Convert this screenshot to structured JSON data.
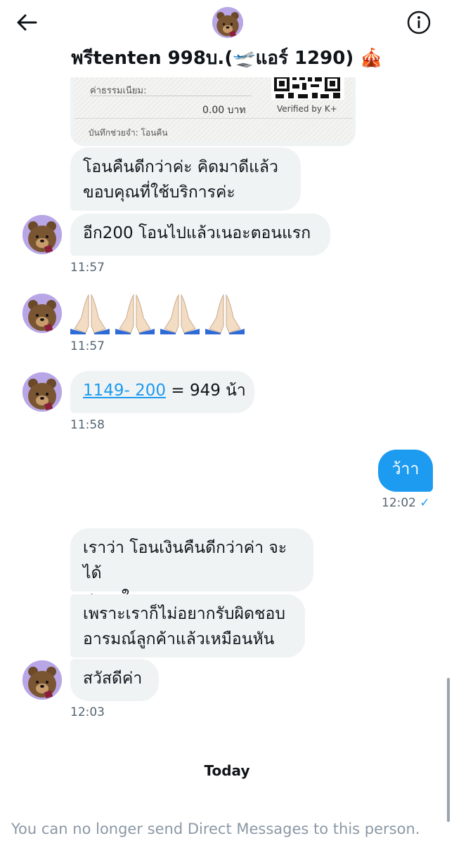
{
  "header": {
    "title": "พรีtenten 998บ.(🛫แอร์ 1290) 🎪",
    "back_icon": "back-arrow-icon",
    "info_icon": "info-icon"
  },
  "receipt": {
    "fee_label": "ค่าธรรมเนียม:",
    "fee_value": "0.00 บาท",
    "verified": "Verified by K+",
    "memo": "บันทึกช่วยจำ: โอนคืน"
  },
  "messages": [
    {
      "line1": "โอนคืนดีกว่าค่ะ คิดมาดีแล้ว",
      "line2": "ขอบคุณที่ใช้บริการค่ะ"
    },
    {
      "text": "อีก200 โอนไปแล้วเนอะตอนแรก",
      "time": "11:57"
    },
    {
      "emoji": "🙏🏻🙏🏻🙏🏻🙏🏻",
      "time": "11:57"
    },
    {
      "link": "1149- 200",
      "rest": " = 949 น้า",
      "time": "11:58"
    },
    {
      "text": "ว้าา",
      "time": "12:02",
      "status": "✓"
    },
    {
      "line1": "เราว่า โอนเงินคืนดีกว่าค่า จะได้",
      "line2": "สบายใจ"
    },
    {
      "line1": "เพราะเราก็ไม่อยากรับผิดชอบ",
      "line2": "อารมณ์ลูกค้าแล้วเหมือนหัน"
    },
    {
      "text": "สวัสดีค่า",
      "time": "12:03"
    }
  ],
  "divider": "Today",
  "notice": "You can no longer send Direct Messages to this person.",
  "colors": {
    "accent": "#1d9bf0",
    "bubble": "#eff3f4",
    "avatar_bg": "#b9a6e6"
  }
}
